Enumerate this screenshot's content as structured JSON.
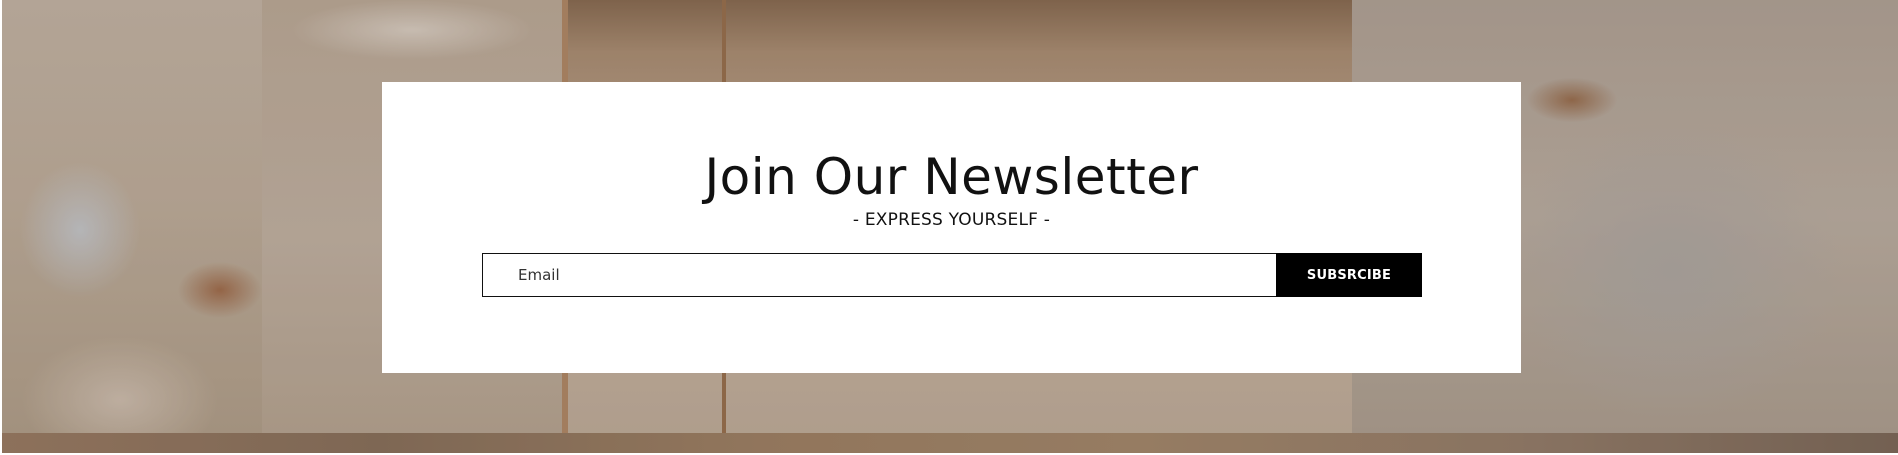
{
  "newsletter": {
    "title": "Join Our Newsletter",
    "subtitle": "- EXPRESS YOURSELF -",
    "email_placeholder": "Email",
    "email_value": "",
    "subscribe_label": "SUBSRCIBE"
  },
  "colors": {
    "card_background": "#ffffff",
    "button_background": "#000000",
    "button_text": "#ffffff",
    "text": "#111111"
  }
}
